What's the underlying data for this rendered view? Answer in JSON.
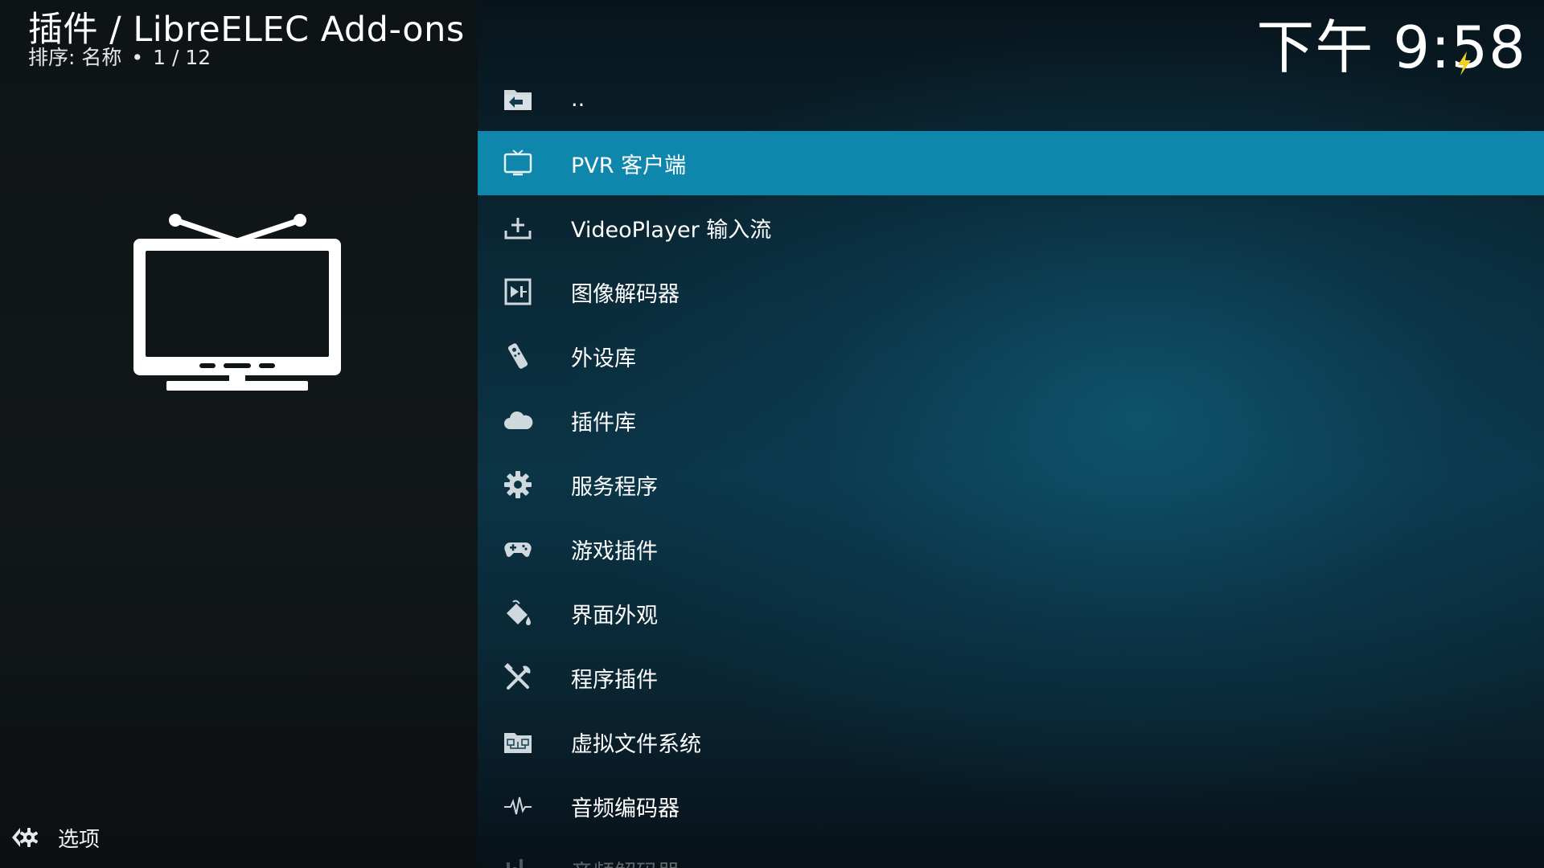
{
  "header": {
    "title": "插件 / LibreELEC Add-ons",
    "sort_label": "排序: 名称",
    "position": "1 / 12",
    "separator": "•"
  },
  "clock": {
    "time": "下午 9:58"
  },
  "footer": {
    "options_label": "选项"
  },
  "colors": {
    "selection": "#0f87ad",
    "bolt": "#f5d21a"
  },
  "list": {
    "items": [
      {
        "label": "..",
        "icon": "folder-back-icon"
      },
      {
        "label": "PVR 客户端",
        "icon": "tv-icon",
        "selected": true
      },
      {
        "label": "VideoPlayer 输入流",
        "icon": "download-tray-icon"
      },
      {
        "label": "图像解码器",
        "icon": "image-decoder-icon"
      },
      {
        "label": "外设库",
        "icon": "remote-control-icon"
      },
      {
        "label": "插件库",
        "icon": "cloud-icon"
      },
      {
        "label": "服务程序",
        "icon": "gear-icon"
      },
      {
        "label": "游戏插件",
        "icon": "gamepad-icon"
      },
      {
        "label": "界面外观",
        "icon": "paint-bucket-icon"
      },
      {
        "label": "程序插件",
        "icon": "tools-icon"
      },
      {
        "label": "虚拟文件系统",
        "icon": "vfs-icon"
      },
      {
        "label": "音频编码器",
        "icon": "waveform-icon"
      },
      {
        "label": "音频解码器",
        "icon": "audio-decoder-icon",
        "faded": true
      }
    ]
  }
}
